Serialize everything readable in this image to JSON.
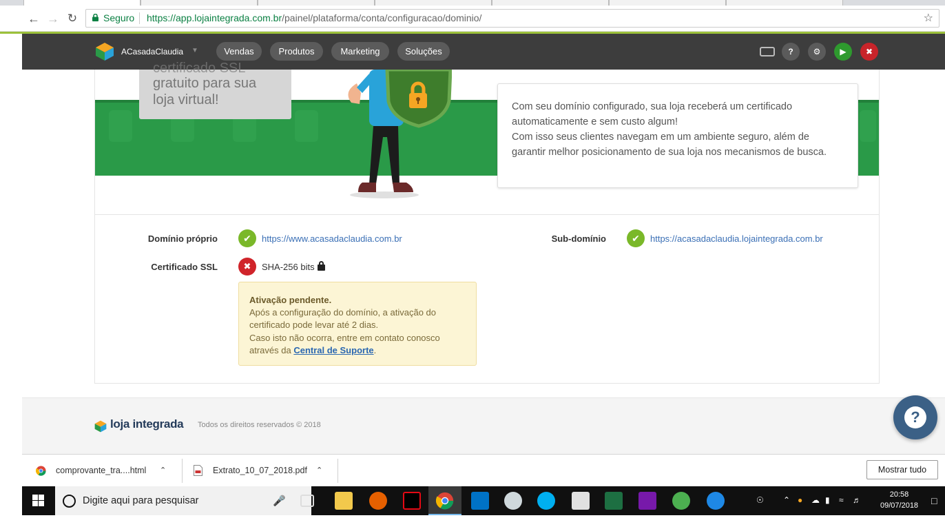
{
  "browser": {
    "secure_label": "Seguro",
    "url_host": "https://app.lojaintegrada.com.br",
    "url_path": "/painel/plataforma/conta/configuracao/dominio/"
  },
  "appnav": {
    "store_name": "ACasadaClaudia",
    "menu": [
      "Vendas",
      "Produtos",
      "Marketing",
      "Soluções"
    ]
  },
  "banner": {
    "grey_title_cut": "certificado SSL",
    "grey_title": "gratuito para sua loja virtual!",
    "info_text_1": "Com seu domínio configurado, sua loja receberá um certificado automaticamente e sem custo algum!",
    "info_text_2": "Com isso seus clientes navegam em um ambiente seguro, além de garantir melhor posicionamento de sua loja nos mecanismos de busca."
  },
  "domain": {
    "own_label": "Domínio próprio",
    "own_value": "https://www.acasadaclaudia.com.br",
    "sub_label": "Sub-domínio",
    "sub_value": "https://acasadaclaudia.lojaintegrada.com.br",
    "ssl_label": "Certificado SSL",
    "ssl_value": "SHA-256 bits",
    "warning_title": "Ativação pendente.",
    "warning_line1": "Após a configuração do domínio, a ativação do certificado pode levar até 2 dias.",
    "warning_line2": "Caso isto não ocorra, entre em contato conosco através da",
    "warning_link": "Central de Suporte",
    "warning_end": "."
  },
  "footer": {
    "logo_text": "loja integrada",
    "copyright": "Todos os direitos reservados © 2018"
  },
  "downloads": {
    "items": [
      "comprovante_tra....html",
      "Extrato_10_07_2018.pdf"
    ],
    "show_all": "Mostrar tudo"
  },
  "taskbar": {
    "search_placeholder": "Digite aqui para pesquisar",
    "time": "20:58",
    "date": "09/07/2018"
  },
  "colors": {
    "brand_green": "#2a9a48",
    "ok_green": "#7ab829",
    "error_red": "#d0242a",
    "link_blue": "#3a6fb5",
    "navbar_dark": "#3d3d3d"
  }
}
